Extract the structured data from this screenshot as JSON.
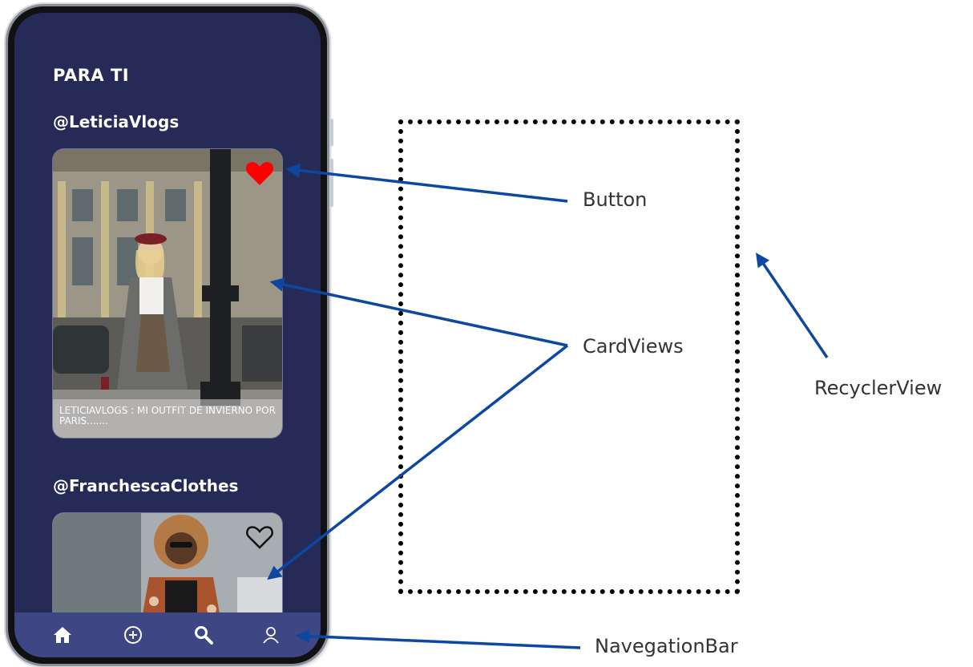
{
  "app": {
    "section_title": "PARA TI"
  },
  "feed": [
    {
      "handle": "@LeticiaVlogs",
      "caption": "LeticiaVlogs : MI OUTFIT DE INVIERNO POR PARIS.......",
      "liked": true
    },
    {
      "handle": "@FranchescaClothes",
      "caption": "",
      "liked": false
    }
  ],
  "navbar": {
    "items": [
      "home-icon",
      "add-circle-icon",
      "search-icon",
      "profile-icon"
    ]
  },
  "annotations": {
    "button": "Button",
    "cardviews": "CardViews",
    "recyclerview": "RecyclerView",
    "navigationbar": "NavegationBar"
  },
  "colors": {
    "screen_bg": "#262a57",
    "navbar_bg": "#3e4784",
    "heart_liked": "#ff0000",
    "arrow": "#0d47a1"
  }
}
